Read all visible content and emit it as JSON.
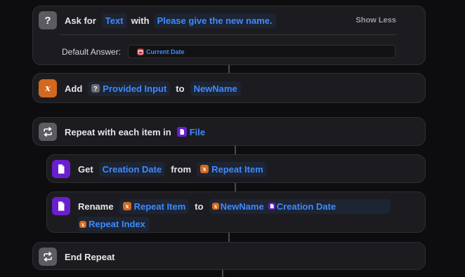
{
  "ask": {
    "label": "Ask for",
    "type_token": "Text",
    "with_word": "with",
    "prompt": "Please give the new name.",
    "show_less": "Show Less",
    "default_answer_label": "Default Answer:",
    "default_answer_token": "Current Date"
  },
  "add": {
    "label": "Add",
    "input_token": "Provided Input",
    "to_word": "to",
    "variable": "NewName"
  },
  "repeat": {
    "label": "Repeat with each item in",
    "source_token": "File"
  },
  "get": {
    "label": "Get",
    "property": "Creation Date",
    "from_word": "from",
    "item_token": "Repeat Item"
  },
  "rename": {
    "label": "Rename",
    "item_token": "Repeat Item",
    "to_word": "to",
    "name_parts": [
      "NewName",
      "Creation Date",
      "Repeat Index"
    ]
  },
  "end_repeat": {
    "label": "End Repeat"
  },
  "icons": {
    "ask": "question-mark-icon",
    "variable": "variable-x-icon",
    "repeat": "repeat-arrows-icon",
    "file": "file-doc-icon",
    "calendar": "calendar-icon"
  },
  "colors": {
    "background": "#0d0d10",
    "card": "#1c1c20",
    "token_text": "#3d8bff",
    "orange": "#d2691e",
    "purple": "#6a1fcf",
    "gray_icon": "#5b5b61"
  }
}
